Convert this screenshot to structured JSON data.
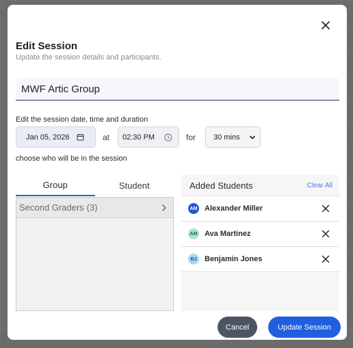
{
  "dialog": {
    "title": "Edit Session",
    "subtitle": "Update the session details and participants."
  },
  "session": {
    "name": "MWF Artic Group",
    "datetime_label": "Edit the session date, time and duration",
    "date": "Jan 05, 2026",
    "at_word": "at",
    "time": "02:30 PM",
    "for_word": "for",
    "duration": "30 mins"
  },
  "participants": {
    "choose_label": "choose who will be in the session",
    "tabs": [
      {
        "label": "Group",
        "active": true
      },
      {
        "label": "Student",
        "active": false
      }
    ],
    "groups": [
      {
        "name": "Second Graders",
        "count": "(3)"
      }
    ],
    "added": {
      "title": "Added Students",
      "clear_label": "Clear All",
      "students": [
        {
          "initials": "AM",
          "name": "Alexander Miller",
          "avatar_bg": "#2457d6",
          "avatar_fg": "#ffffff"
        },
        {
          "initials": "AM",
          "name": "Ava Martinez",
          "avatar_bg": "#a8e6cf",
          "avatar_fg": "#1d6b4a"
        },
        {
          "initials": "BJ",
          "name": "Benjamin Jones",
          "avatar_bg": "#a9d8f5",
          "avatar_fg": "#1b4f80"
        }
      ]
    }
  },
  "actions": {
    "cancel": "Cancel",
    "update": "Update Session"
  },
  "colors": {
    "primary": "#1f5fe0",
    "secondary_button": "#4d5563",
    "active_tab_underline": "#2e5bd9"
  },
  "icons": {
    "close": "close-icon",
    "calendar": "calendar-icon",
    "clock": "clock-icon",
    "select_chevron": "chevron-down-icon",
    "group_chevron": "chevron-right-icon",
    "remove": "remove-icon"
  }
}
